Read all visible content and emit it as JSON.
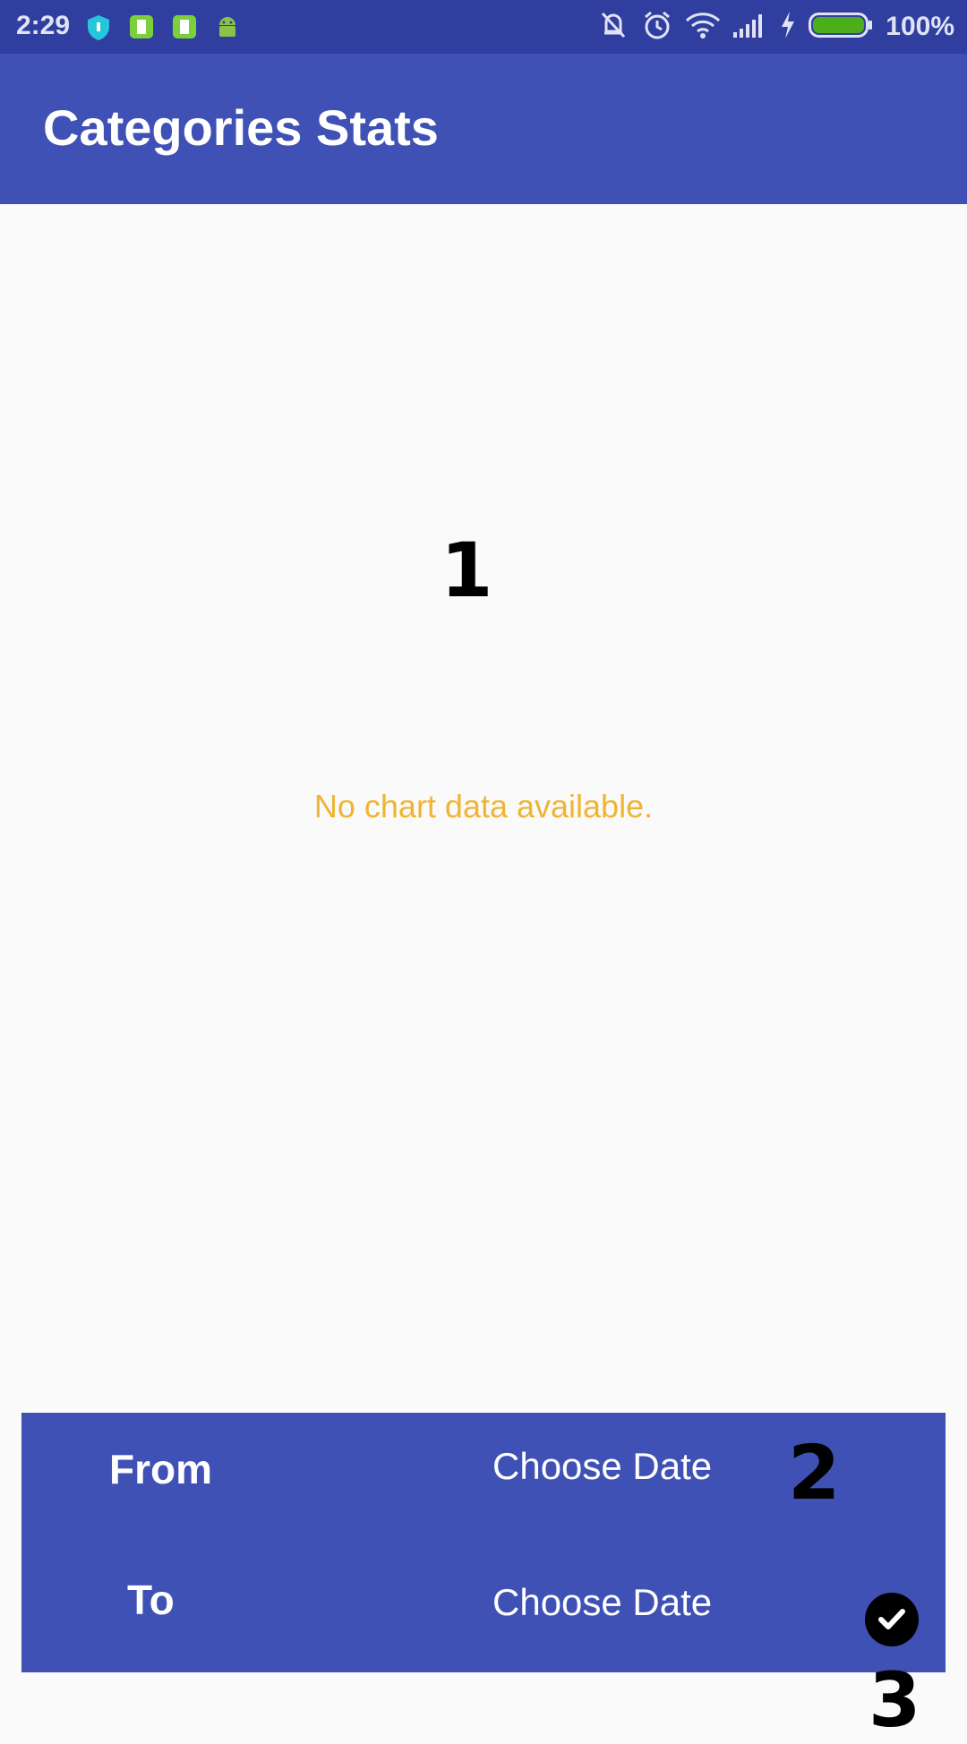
{
  "status_bar": {
    "time": "2:29",
    "battery_percent": "100%",
    "battery_level": 1.0,
    "icons": [
      "shield-icon",
      "battery-app-icon",
      "battery-app-icon",
      "android-icon",
      "silent-icon",
      "alarm-icon",
      "wifi-icon",
      "signal-icon",
      "charging-icon",
      "battery-icon"
    ]
  },
  "app_bar": {
    "title": "Categories Stats"
  },
  "chart": {
    "empty_message": "No chart data available."
  },
  "markers": {
    "m1": "1",
    "m2": "2",
    "m3": "3"
  },
  "date_range": {
    "from_label": "From",
    "from_value": "Choose Date",
    "to_label": "To",
    "to_value": "Choose Date"
  },
  "colors": {
    "primary": "#3f51b5",
    "primary_dark": "#303f9f",
    "empty_text": "#f0b432",
    "background": "#fafafa"
  }
}
